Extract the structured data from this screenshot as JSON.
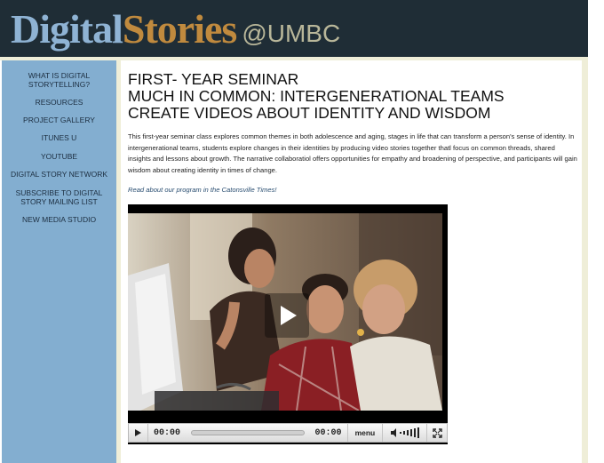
{
  "header": {
    "logo_part1": "Digital",
    "logo_part2": "Stories",
    "logo_at": "@",
    "logo_org": "UMBC"
  },
  "sidebar": {
    "items": [
      {
        "label_line1": "WHAT IS DIGITAL",
        "label_line2": "STORYTELLING?"
      },
      {
        "label_line1": "RESOURCES"
      },
      {
        "label_line1": "PROJECT GALLERY"
      },
      {
        "label_line1": "ITUNES U"
      },
      {
        "label_line1": "YOUTUBE"
      },
      {
        "label_line1": "DIGITAL STORY NETWORK"
      },
      {
        "label_line1": "SUBSCRIBE TO DIGITAL",
        "label_line2": "STORY MAILING LIST"
      },
      {
        "label_line1": "NEW MEDIA STUDIO"
      }
    ]
  },
  "main": {
    "title_lines": [
      "FIRST- YEAR SEMINAR",
      "MUCH IN COMMON: INTERGENERATIONAL TEAMS",
      "CREATE VIDEOS ABOUT IDENTITY AND WISDOM"
    ],
    "intro": "This first-year seminar class explores common themes in both adolescence and  aging, stages in life that can transform a person's sense of identity. In intergenerational teams, students explore changes in their identities by producing video stories together thatl focus on common threads, shared insights and lessons about growth. The narrative collaboratiol offers opportunities for empathy and broadening of perspective, and participants will gain wisdom about creating identity in times of change.",
    "news_link": "Read about our program in the Catonsville Times!"
  },
  "video": {
    "current_time": "00:00",
    "duration": "00:00",
    "menu_label": "menu",
    "progress": 0
  },
  "colors": {
    "header_bg": "#1f2d36",
    "sidebar_bg": "#83aed0",
    "logo_blue": "#8fb3d4",
    "logo_gold": "#c08a3e",
    "strip": "#efeed8"
  }
}
